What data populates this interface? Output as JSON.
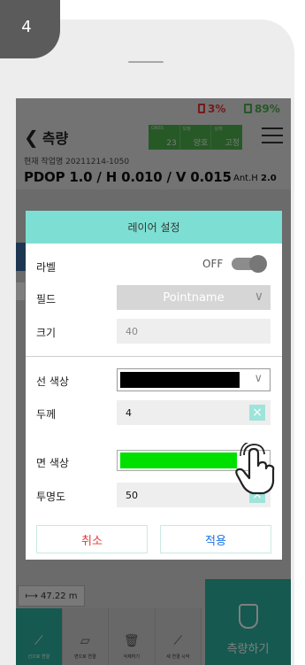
{
  "step": {
    "number": "4"
  },
  "status_bar": {
    "battery1": "3%",
    "battery2": "89%",
    "colors": {
      "battery1": "#e8353a",
      "battery2": "#4caf50"
    }
  },
  "top_bar": {
    "back_label": "측량",
    "gnss": [
      {
        "label": "GNSS",
        "value": "23"
      },
      {
        "label": "보정",
        "value": "양호"
      },
      {
        "label": "상태",
        "value": "고정"
      }
    ]
  },
  "job": {
    "name": "현재 작업명 20211214-1050"
  },
  "precision": {
    "text": "PDOP 1.0 / H 0.010 / V 0.015",
    "anth_label": "Ant.H",
    "anth_value": "2.0"
  },
  "map": {
    "scale": "47.22 m"
  },
  "toolbar": {
    "items": [
      {
        "label": "선으로 연결",
        "icon": "line-connect-icon"
      },
      {
        "label": "면으로 연결",
        "icon": "polygon-connect-icon"
      },
      {
        "label": "삭제하기",
        "icon": "trash-icon"
      },
      {
        "label": "새 연결 시작",
        "icon": "new-connection-icon"
      }
    ],
    "measure_label": "측량하기"
  },
  "dialog": {
    "title": "레이어 설정",
    "label_row": {
      "label": "라벨",
      "toggle_text": "OFF"
    },
    "field_row": {
      "label": "필드",
      "value": "Pointname"
    },
    "size_row": {
      "label": "크기",
      "value": "40"
    },
    "line_color_row": {
      "label": "선 색상",
      "color": "#000000"
    },
    "thickness_row": {
      "label": "두께",
      "value": "4"
    },
    "face_color_row": {
      "label": "면 색상",
      "color": "#00e000"
    },
    "opacity_row": {
      "label": "투명도",
      "value": "50"
    },
    "cancel_label": "취소",
    "apply_label": "적용"
  },
  "accent_color": "#2bb3a1"
}
